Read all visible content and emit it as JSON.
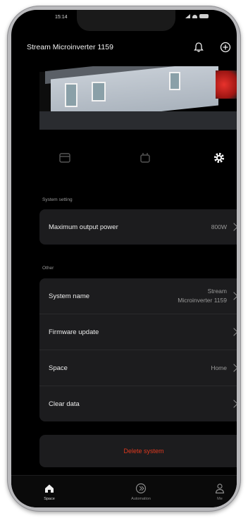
{
  "app": {
    "title": "Stream Microinverter 1159"
  },
  "status_bar": {
    "time": "15:14"
  },
  "header": {
    "icons": [
      "bell-icon",
      "plus-circle-icon"
    ]
  },
  "tabs": [
    {
      "icon": "dashboard-icon",
      "active": false
    },
    {
      "icon": "device-icon",
      "active": false
    },
    {
      "icon": "settings-gear-icon",
      "active": true
    }
  ],
  "system_setting": {
    "label": "System setting",
    "rows": [
      {
        "label": "Maximum output power",
        "value": "800W"
      }
    ]
  },
  "other": {
    "label": "Other",
    "rows": [
      {
        "label": "System name",
        "value_line1": "Stream",
        "value_line2": "Microinverter 1159"
      },
      {
        "label": "Firmware update",
        "value": ""
      },
      {
        "label": "Space",
        "value": "Home"
      },
      {
        "label": "Clear data",
        "value": ""
      }
    ]
  },
  "delete_button": {
    "label": "Delete system",
    "color": "#e0391e"
  },
  "bottom_nav": [
    {
      "label": "Space",
      "icon": "home-icon",
      "active": true
    },
    {
      "label": "Automation",
      "icon": "automation-icon",
      "active": false
    },
    {
      "label": "Me",
      "icon": "user-icon",
      "active": false
    }
  ],
  "colors": {
    "background": "#000000",
    "card": "#1c1c1e",
    "accent_red": "#e0391e"
  }
}
